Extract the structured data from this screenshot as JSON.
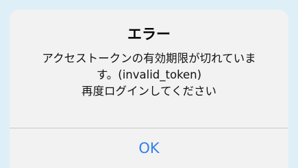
{
  "dialog": {
    "title": "エラー",
    "message_lines": [
      "アクセストークンの有効期限が切れていま",
      "す。(invalid_token)",
      "再度ログインしてください"
    ],
    "ok_label": "OK"
  },
  "colors": {
    "backdrop": "#dfeff8",
    "dialog_background": "#f2f2f2",
    "divider": "#c7c7c9",
    "button_text": "#2f80ed"
  }
}
